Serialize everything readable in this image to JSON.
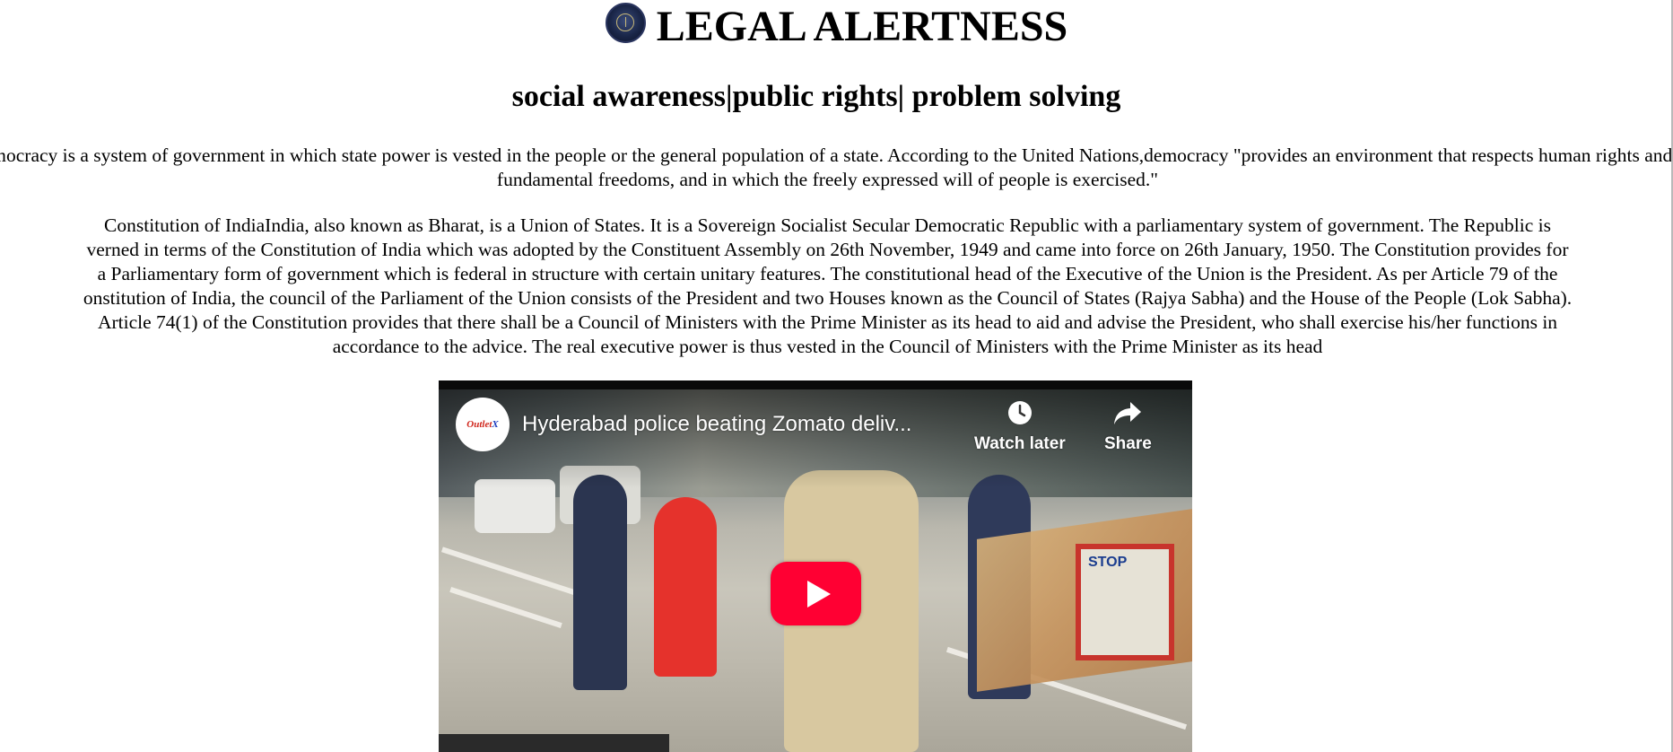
{
  "header": {
    "site_title": "LEGAL ALERTNESS",
    "tagline": "social awareness|public rights| problem solving",
    "logo_icon": "court-seal-icon"
  },
  "content": {
    "paragraph_1": "emocracy is a system of government in which state power is vested in the people or the general population of a state. According to the United Nations,democracy \"provides an environment that respects human rights and fundamental freedoms, and in which the freely expressed will of people is exercised.\"",
    "paragraph_2_lines": [
      "Constitution of IndiaIndia, also known as Bharat, is a Union of States. It is a Sovereign Socialist Secular Democratic Republic with a parliamentary system of government. The Republic is",
      "verned in terms of the Constitution of India which was adopted by the Constituent Assembly on 26th November, 1949 and came into force on 26th January, 1950. The Constitution provides for",
      "a Parliamentary form of government which is federal in structure with certain unitary features. The constitutional head of the Executive of the Union is the President. As per Article 79 of the",
      "onstitution of India, the council of the Parliament of the Union consists of the President and two Houses known as the Council of States (Rajya Sabha) and the House of the People (Lok Sabha).",
      "Article 74(1) of the Constitution provides that there shall be a Council of Ministers with the Prime Minister as its head to aid and advise the President, who shall exercise his/her functions in",
      "accordance to the advice. The real executive power is thus vested in the Council of Ministers with the Prime Minister as its head"
    ]
  },
  "video": {
    "title": "Hyderabad police beating Zomato deliv...",
    "channel_name_part1": "Outlet",
    "channel_name_part2": " X",
    "watch_later_label": "Watch later",
    "share_label": "Share",
    "stop_sign_text": "STOP",
    "play_button_color": "#ff0033",
    "icons": {
      "watch_later": "clock-icon",
      "share": "share-arrow-icon",
      "play": "play-icon"
    }
  }
}
